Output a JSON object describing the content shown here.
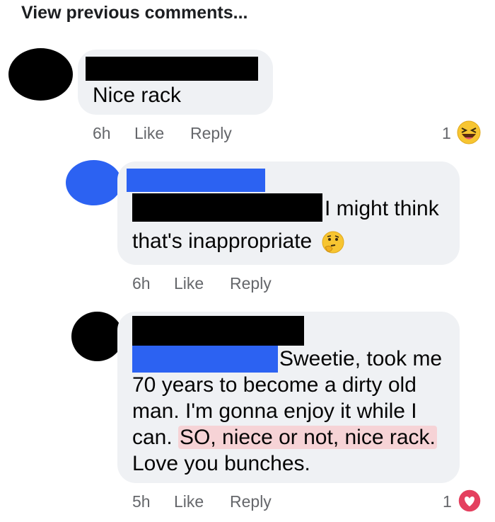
{
  "header": {
    "view_previous": "View previous comments..."
  },
  "comments": [
    {
      "avatar_color": "#000000",
      "text": "Nice rack",
      "time": "6h",
      "like_label": "Like",
      "reply_label": "Reply",
      "reaction_count": "1",
      "reaction_icon": "laughing-emoji-icon"
    },
    {
      "avatar_color": "#2c62f2",
      "line1": "I might think",
      "line2": "that's inappropriate",
      "line2_emoji": "thinking-face-emoji-icon",
      "time": "6h",
      "like_label": "Like",
      "reply_label": "Reply"
    },
    {
      "avatar_color": "#000000",
      "line1": "Sweetie, took me",
      "line2": "70 years to become a dirty old",
      "line3": "man. I'm gonna enjoy it while I",
      "line4_start": "can. ",
      "line4_highlight": "SO, niece or not, nice rack.",
      "line5": "Love you bunches.",
      "time": "5h",
      "like_label": "Like",
      "reply_label": "Reply",
      "reaction_count": "1",
      "reaction_icon": "heart-reaction-icon"
    }
  ],
  "colors": {
    "bubble": "#eff1f4",
    "redaction_black": "#000000",
    "redaction_blue": "#2c62f2",
    "highlight": "#f6d3d6",
    "heart": "#e4405f"
  }
}
